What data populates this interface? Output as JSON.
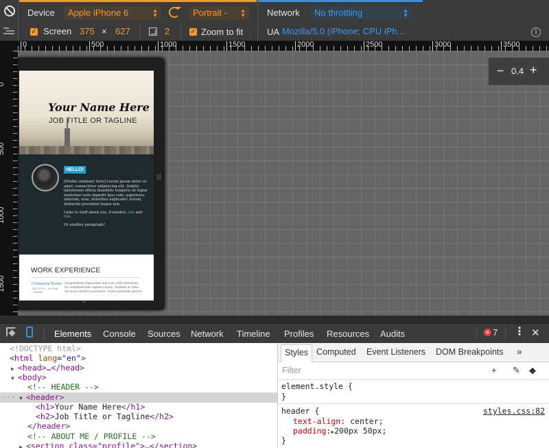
{
  "toolbar": {
    "device_label": "Device",
    "device_value": "Apple iPhone 6",
    "orientation_value": "Portrait -",
    "screen_label": "Screen",
    "screen_width": "375",
    "times": "×",
    "screen_height": "627",
    "dpr_value": "2",
    "zoom_to_fit_label": "Zoom to fit",
    "network_label": "Network",
    "network_value": "No throttling",
    "ua_label": "UA",
    "ua_value": "Mozilla/5.0 (iPhone; CPU iPh...",
    "info_glyph": "i"
  },
  "rulers": {
    "horizontal": [
      "0",
      "500",
      "1000",
      "1500",
      "2000",
      "2500",
      "3000",
      "3500"
    ],
    "vertical": [
      "0",
      "500",
      "1000",
      "1500"
    ]
  },
  "zoom": {
    "minus": "−",
    "value": "0.4",
    "plus": "+"
  },
  "preview": {
    "name": "Your Name Here",
    "tagline": "JOB TITLE OR TAGLINE",
    "hello": "HELLO!",
    "profile_p1": "[Profile summary here] Lorem ipsum dolor sit amet, consectetur adipisicing elit. Debitis laboriosam officia blanditiis tempora sit fugiat molestiae iusto impedit ipsa cum, asperiores laborum, esse, doloribus explicabo! Autem, distinctio provident itaque non.",
    "profile_p2_a": "Links to stuff about you, if needed.",
    "profile_p2_link1": "link",
    "profile_p2_and": "and",
    "profile_p2_link2": "link",
    "profile_p3": "Or another paragraph!",
    "work_heading": "WORK EXPERIENCE",
    "company": "Company Name",
    "job_meta": "JOB TITLE · Jul 2014 - Present",
    "job_text": "Suspendisse dignissim nisi non velit interdum, in condimentum sapien varius. Nullam ac felis eu lacus rhoncus posuere. Fusce pretium auctor"
  },
  "devtools": {
    "tabs": [
      "Elements",
      "Console",
      "Sources",
      "Network",
      "Timeline",
      "Profiles",
      "Resources",
      "Audits"
    ],
    "error_count": "7",
    "kebab": "⋮",
    "close": "✕",
    "dom": {
      "doctype": "<!DOCTYPE html>",
      "html_open": "<html",
      "html_attr": "lang",
      "html_val": "\"en\"",
      "head": "<head>…</head>",
      "body": "<body>",
      "comment_header": "<!-- HEADER -->",
      "header_open": "<header>",
      "h1_open": "<h1>",
      "h1_text": "Your Name Here",
      "h1_close": "</h1>",
      "h2_open": "<h2>",
      "h2_text": "Job Title or Tagline",
      "h2_close": "</h2>",
      "header_close": "</header>",
      "comment_about": "<!-- ABOUT ME / PROFILE -->",
      "section_line": "<section class=\"profile\">…</section>"
    },
    "styles_tabs": [
      "Styles",
      "Computed",
      "Event Listeners",
      "DOM Breakpoints"
    ],
    "more": "»",
    "filter_placeholder": "Filter",
    "plus_icon": "+",
    "element_style": "element.style {",
    "close_brace": "}",
    "rule_selector": "header {",
    "rule_source": "styles.css:82",
    "prop1_name": "text-align",
    "prop1_value": "center;",
    "prop2_name": "padding",
    "prop2_value": "200px 50px;"
  },
  "colors": {
    "accent_orange": "#f29a2e",
    "accent_blue": "#3b8fdf",
    "error_red": "#e0443e"
  }
}
